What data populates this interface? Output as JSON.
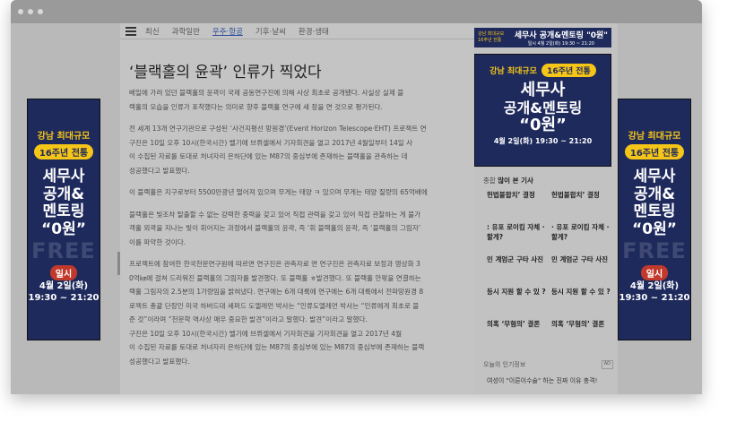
{
  "nav": {
    "items": [
      "최신",
      "과학일반",
      "우주·항공",
      "기후·날씨",
      "환경·생태"
    ],
    "active_index": 2
  },
  "article": {
    "title": "‘블랙홀의 윤곽’ 인류가 찍었다",
    "paragraphs": [
      "베일에 가려 있던 블랙홀의 윤곽이 국제 공동연구진에 의해 사상 최초로 공개됐다. 사실상 실제 블",
      "랙홀의 모습을 인류가 포착했다는 의미로 향후 블랙홀 연구에 새 장을 연 것으로 평가된다.",
      "전 세계 13개 연구기관으로 구성된 ‘사건지평선 망원경’(Event Horizon Telescope·EHT) 프로젝트 연",
      "구진은 10일 오후 10시(한국시간) 벨기에 브뤼셀에서 기자회견을 열고 2017년 4월일부터 14일 사",
      "이 수집된 자료를 토대로 처녀자리 은하단에 있는 M87의 중심부에 존재하는 블랙홀을 관측하는 데",
      "성공했다고 발표했다.",
      "이 블랙홀은 지구로부터 5500만광년 떨어져 있으며 무게는 태양 ㅋ 있으며 무게는 태양 질량의 65억배에",
      "블랙홀은 빛조차 탈출할 수 없는 강력한 중력을 갖고 있어 직접 관력을 갖고 있어 직접 관찰하는 게 불가",
      "객홀 외곽을 지나는 빛이 휘어지는 과정에서 블랙홀의 윤곽, 즉 ‘휘 블랙홀의 윤곽, 즉 ‘블랙홀의 그림자’",
      "이를 파악한 것이다.",
      "프로젝트에 참여한 한국천문연구원에 따르면 연구진은 관측자료 면 연구진은 관측자료 보정과 영상화 3",
      "0억㎞에 걸쳐 드리워진 블랙홀의 그림자를 발견했다. 또 블랙홀 ㅎ발견했다. 또 블랙홀 안팎을 연결하는",
      "랙홀 그림자의 2.5분의 1가량임을 밝혀냈다. 연구에는 6개 대륙에 연구에는 6개 대륙에서 전파망원경 8",
      "로젝트 총괄 단장인 미국 하버드대 셰퍼드 도엘레먼 박사는 “인류도엘레먼 박사는 “인류에게 최초로 블",
      "준 것”이라며 “천문학 역사상 매우 중요한 발견”이라고 말했다. 발견”이라고 말했다.",
      "구진은 10일 오후 10시(한국시간) 벨기에 브뤼셀에서 기자회견을 기자회견을 열고 2017년 4월",
      "이 수집된 자료를 토대로 처녀자리 은하단에 있는 M87의 중심부에 있는 M87의 중심부에 존재하는 블랙",
      "성공했다고 발표했다."
    ]
  },
  "banner": {
    "top": "강남 최대규모",
    "pill": "16주년 전통",
    "line1": "세무사",
    "line2": "공개&",
    "line3": "멘토링",
    "line4": "“0원”",
    "free": "FREE",
    "time_label": "일시",
    "date": "4월 2일(화)",
    "time": "19:30 ~ 21:20",
    "center_line2": "공개&멘토링",
    "center_date": "4월 2일(화) 19:30 ~ 21:20"
  },
  "thin_banner": {
    "left": "강남 최대규모 16주년 전통",
    "title": "세무사 공개&멘토링 \"0원\"",
    "sub": "일시 4월 2일(화) 19:30 ~ 21:20"
  },
  "popular": {
    "label_prefix": "종합",
    "label": "많이 본 기사",
    "rows": [
      [
        "헌법불합치’ 결정",
        "헌법불합치’ 결정"
      ],
      [
        ": 유포 로이킴 자체 ·할게?",
        "· 유포 로이킴 자체 ·할게?"
      ],
      [
        "민 계엄군 구타 사진",
        "민 계엄군 구타 사진"
      ],
      [
        "등시 지원 할 수 있 ?",
        "등시 지원 할 수 있 ?"
      ],
      [
        "의혹 ‘무혐의’ 결론",
        "의혹 ‘무혐의’ 결론"
      ]
    ]
  },
  "today": {
    "label": "오늘의 인기정보",
    "badge": "AD",
    "item": "여성이 \"이른이수술\" 하는 진짜 이유 충격!"
  }
}
